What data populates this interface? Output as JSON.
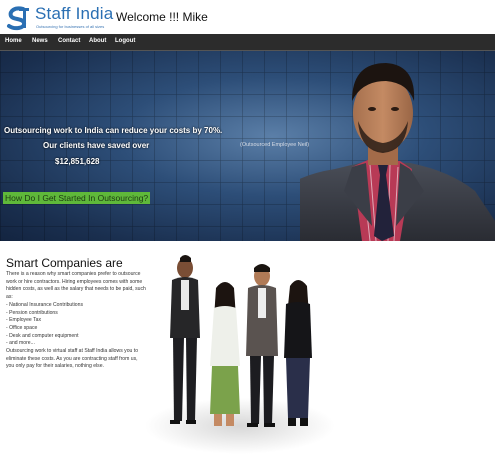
{
  "header": {
    "logo_name": "Staff India",
    "logo_tagline": "Outsourcing for businesses of all sizes",
    "welcome": "Welcome !!! Mike"
  },
  "nav": {
    "items": [
      "Home",
      "News",
      "Contact",
      "About",
      "Logout"
    ]
  },
  "hero": {
    "line1": "Outsourcing work to India can reduce your costs by 70%.",
    "line2": "Our clients have saved over",
    "amount": "$12,851,628",
    "caption": "(Outsourced Employee Neil)",
    "cta": "How Do I Get Started In Outsourcing?"
  },
  "content": {
    "title": "Smart Companies are",
    "intro": "There is a reason why smart companies prefer to outsource work or hire contractors. Hiring employees comes with some hidden costs, as well as the salary that needs to be paid, such as:",
    "list": [
      "- National Insurance Contributions",
      "- Pension contributions",
      "- Employee Tax",
      "- Office space",
      "- Desk and computer equipment",
      "- and more..."
    ],
    "outro": "Outsourcing work to virtual staff at Staff India allows you to eliminate these costs. As you are contracting staff from us, you only pay for their salaries, nothing else."
  },
  "colors": {
    "brand_blue": "#2a6fb3",
    "nav_bg": "#2c2c2c",
    "cta_green": "#5fb83a"
  }
}
